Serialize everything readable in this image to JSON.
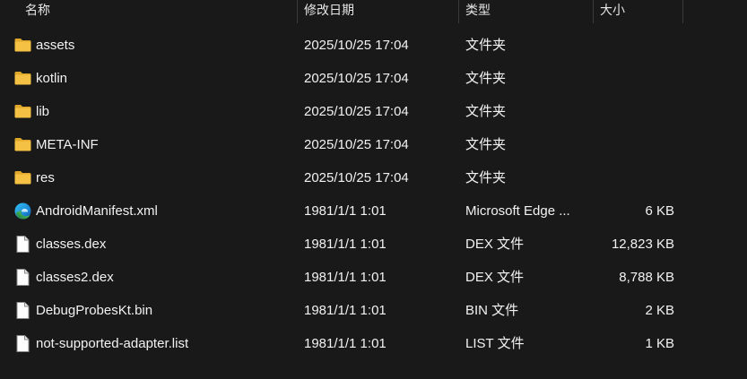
{
  "columns": {
    "name": "名称",
    "date": "修改日期",
    "type": "类型",
    "size": "大小"
  },
  "files": [
    {
      "name": "assets",
      "date": "2025/10/25 17:04",
      "type": "文件夹",
      "size": "",
      "icon": "folder-icon"
    },
    {
      "name": "kotlin",
      "date": "2025/10/25 17:04",
      "type": "文件夹",
      "size": "",
      "icon": "folder-icon"
    },
    {
      "name": "lib",
      "date": "2025/10/25 17:04",
      "type": "文件夹",
      "size": "",
      "icon": "folder-icon"
    },
    {
      "name": "META-INF",
      "date": "2025/10/25 17:04",
      "type": "文件夹",
      "size": "",
      "icon": "folder-icon"
    },
    {
      "name": "res",
      "date": "2025/10/25 17:04",
      "type": "文件夹",
      "size": "",
      "icon": "folder-icon"
    },
    {
      "name": "AndroidManifest.xml",
      "date": "1981/1/1 1:01",
      "type": "Microsoft Edge ...",
      "size": "6 KB",
      "icon": "edge-icon"
    },
    {
      "name": "classes.dex",
      "date": "1981/1/1 1:01",
      "type": "DEX 文件",
      "size": "12,823 KB",
      "icon": "file-icon"
    },
    {
      "name": "classes2.dex",
      "date": "1981/1/1 1:01",
      "type": "DEX 文件",
      "size": "8,788 KB",
      "icon": "file-icon"
    },
    {
      "name": "DebugProbesKt.bin",
      "date": "1981/1/1 1:01",
      "type": "BIN 文件",
      "size": "2 KB",
      "icon": "file-icon"
    },
    {
      "name": "not-supported-adapter.list",
      "date": "1981/1/1 1:01",
      "type": "LIST 文件",
      "size": "1 KB",
      "icon": "file-icon"
    }
  ],
  "colors": {
    "background": "#191919",
    "folder": "#f4c144",
    "folder_dark": "#e0a82a"
  }
}
